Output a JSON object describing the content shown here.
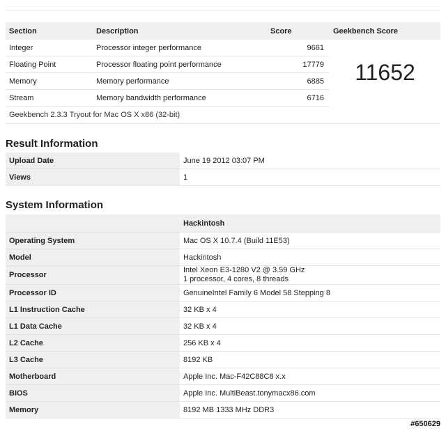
{
  "score_table": {
    "headers": {
      "section": "Section",
      "description": "Description",
      "score": "Score",
      "geekbench": "Geekbench Score"
    },
    "rows": [
      {
        "section": "Integer",
        "description": "Processor integer performance",
        "score": "9661"
      },
      {
        "section": "Floating Point",
        "description": "Processor floating point performance",
        "score": "17779"
      },
      {
        "section": "Memory",
        "description": "Memory performance",
        "score": "6885"
      },
      {
        "section": "Stream",
        "description": "Memory bandwidth performance",
        "score": "6716"
      }
    ],
    "total_score": "11652",
    "footer": "Geekbench 2.3.3 Tryout for Mac OS X x86 (32-bit)"
  },
  "result_info": {
    "title": "Result Information",
    "rows": [
      {
        "key": "Upload Date",
        "value": "June 19 2012 03:07 PM"
      },
      {
        "key": "Views",
        "value": "1"
      }
    ]
  },
  "system_info": {
    "title": "System Information",
    "header_value": "Hackintosh",
    "rows": [
      {
        "key": "Operating System",
        "value": "Mac OS X 10.7.4 (Build 11E53)"
      },
      {
        "key": "Model",
        "value": "Hackintosh"
      },
      {
        "key": "Processor",
        "value": "Intel Xeon E3-1280 V2 @ 3.59 GHz",
        "value2": "1 processor, 4 cores, 8 threads"
      },
      {
        "key": "Processor ID",
        "value": "GenuineIntel Family 6 Model 58 Stepping 8"
      },
      {
        "key": "L1 Instruction Cache",
        "value": "32 KB x 4"
      },
      {
        "key": "L1 Data Cache",
        "value": "32 KB x 4"
      },
      {
        "key": "L2 Cache",
        "value": "256 KB x 4"
      },
      {
        "key": "L3 Cache",
        "value": "8192 KB"
      },
      {
        "key": "Motherboard",
        "value": "Apple Inc. Mac-F42C88C8 x.x"
      },
      {
        "key": "BIOS",
        "value": "Apple Inc. MultiBeast.tonymacx86.com"
      },
      {
        "key": "Memory",
        "value": "8192 MB 1333 MHz DDR3"
      }
    ]
  },
  "watermark": "#650629"
}
